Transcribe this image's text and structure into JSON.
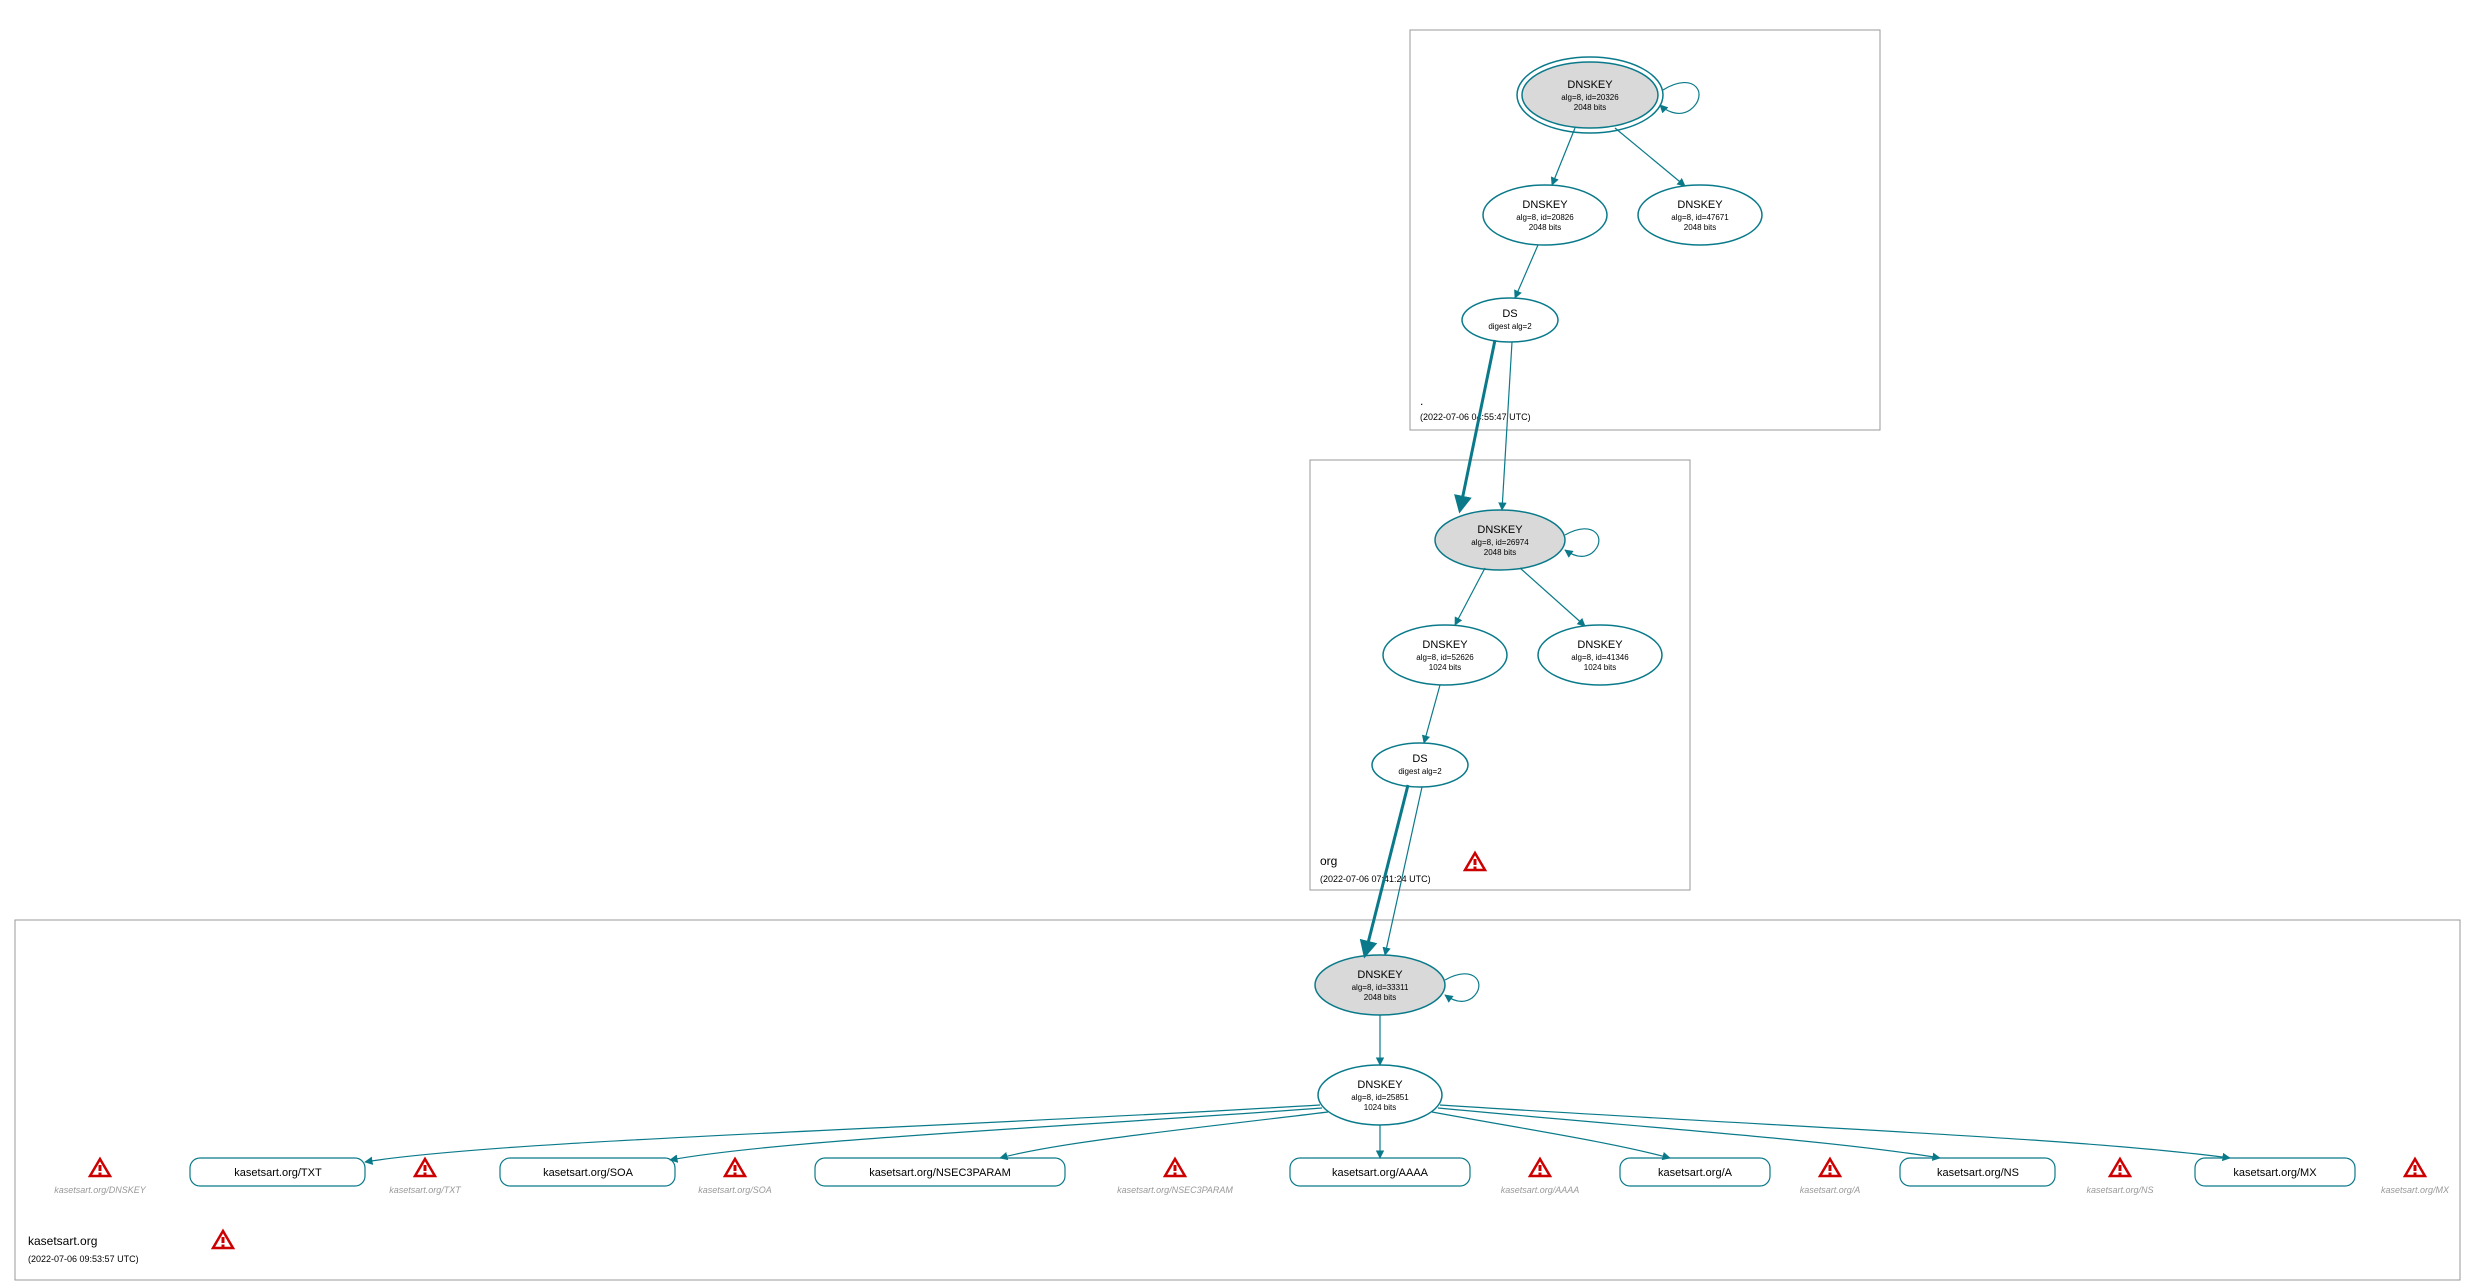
{
  "zones": {
    "root": {
      "label": ".",
      "time": "(2022-07-06 04:55:47 UTC)"
    },
    "org": {
      "label": "org",
      "time": "(2022-07-06 07:41:24 UTC)"
    },
    "domain": {
      "label": "kasetsart.org",
      "time": "(2022-07-06 09:53:57 UTC)"
    }
  },
  "nodes": {
    "root_ksk": {
      "t": "DNSKEY",
      "s1": "alg=8, id=20326",
      "s2": "2048 bits"
    },
    "root_zsk1": {
      "t": "DNSKEY",
      "s1": "alg=8, id=20826",
      "s2": "2048 bits"
    },
    "root_zsk2": {
      "t": "DNSKEY",
      "s1": "alg=8, id=47671",
      "s2": "2048 bits"
    },
    "root_ds": {
      "t": "DS",
      "s1": "digest alg=2"
    },
    "org_ksk": {
      "t": "DNSKEY",
      "s1": "alg=8, id=26974",
      "s2": "2048 bits"
    },
    "org_zsk1": {
      "t": "DNSKEY",
      "s1": "alg=8, id=52626",
      "s2": "1024 bits"
    },
    "org_zsk2": {
      "t": "DNSKEY",
      "s1": "alg=8, id=41346",
      "s2": "1024 bits"
    },
    "org_ds": {
      "t": "DS",
      "s1": "digest alg=2"
    },
    "dom_ksk": {
      "t": "DNSKEY",
      "s1": "alg=8, id=33311",
      "s2": "2048 bits"
    },
    "dom_zsk": {
      "t": "DNSKEY",
      "s1": "alg=8, id=25851",
      "s2": "1024 bits"
    }
  },
  "rrsets": {
    "txt": "kasetsart.org/TXT",
    "soa": "kasetsart.org/SOA",
    "nsec3": "kasetsart.org/NSEC3PARAM",
    "aaaa": "kasetsart.org/AAAA",
    "a": "kasetsart.org/A",
    "ns": "kasetsart.org/NS",
    "mx": "kasetsart.org/MX"
  },
  "faded": {
    "dnskey": "kasetsart.org/DNSKEY",
    "txt": "kasetsart.org/TXT",
    "soa": "kasetsart.org/SOA",
    "nsec3": "kasetsart.org/NSEC3PARAM",
    "aaaa": "kasetsart.org/AAAA",
    "a": "kasetsart.org/A",
    "ns": "kasetsart.org/NS",
    "mx": "kasetsart.org/MX"
  }
}
